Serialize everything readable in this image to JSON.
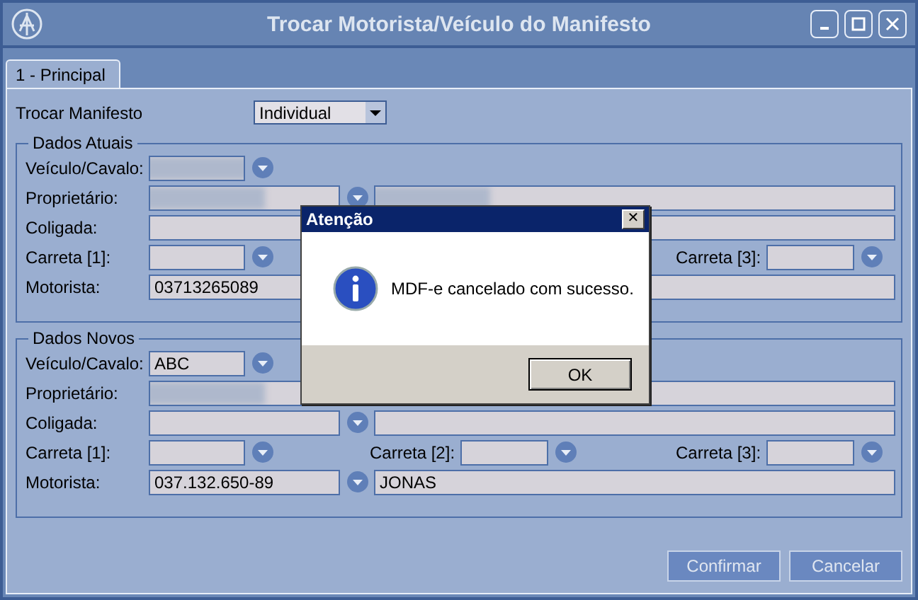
{
  "window": {
    "title": "Trocar Motorista/Veículo do Manifesto"
  },
  "tabs": [
    {
      "label": "1 - Principal",
      "selected": true
    }
  ],
  "mode": {
    "label": "Trocar Manifesto",
    "value": "Individual"
  },
  "groups": [
    {
      "title": "Dados Atuais",
      "rows": [
        {
          "kind": "vehicle",
          "label": "Veículo/Cavalo:",
          "redacted": true,
          "lookup": true
        },
        {
          "kind": "lookup_desc",
          "label": "Proprietário:",
          "redacted": true,
          "lookup": true,
          "desc_redacted": true
        },
        {
          "kind": "plain",
          "label": "Coligada:"
        },
        {
          "kind": "carretas",
          "segments": [
            {
              "kind": "carreta",
              "label": "Carreta [1]:"
            },
            {
              "kind": "blank"
            },
            {
              "kind": "carreta",
              "label": "Carreta [3]:"
            }
          ]
        },
        {
          "kind": "lookup_desc",
          "label": "Motorista:",
          "value": "03713265089",
          "lookup": false
        }
      ]
    },
    {
      "title": "Dados Novos",
      "rows": [
        {
          "kind": "vehicle",
          "label": "Veículo/Cavalo:",
          "value": "ABC",
          "lookup": true
        },
        {
          "kind": "lookup_desc",
          "label": "Proprietário:",
          "redacted": true,
          "lookup": false
        },
        {
          "kind": "lookup_desc",
          "label": "Coligada:",
          "lookup": true
        },
        {
          "kind": "carretas",
          "segments": [
            {
              "kind": "carreta",
              "label": "Carreta [1]:"
            },
            {
              "kind": "carreta",
              "label": "Carreta [2]:"
            },
            {
              "kind": "carreta",
              "label": "Carreta [3]:"
            }
          ]
        },
        {
          "kind": "lookup_desc",
          "label": "Motorista:",
          "value": "037.132.650-89",
          "lookup": true,
          "desc": "JONAS"
        }
      ]
    }
  ],
  "buttons": [
    "Confirmar",
    "Cancelar"
  ],
  "dialog": {
    "title": "Atenção",
    "close": "✕",
    "message": "MDF-e cancelado com sucesso.",
    "button": "OK"
  }
}
